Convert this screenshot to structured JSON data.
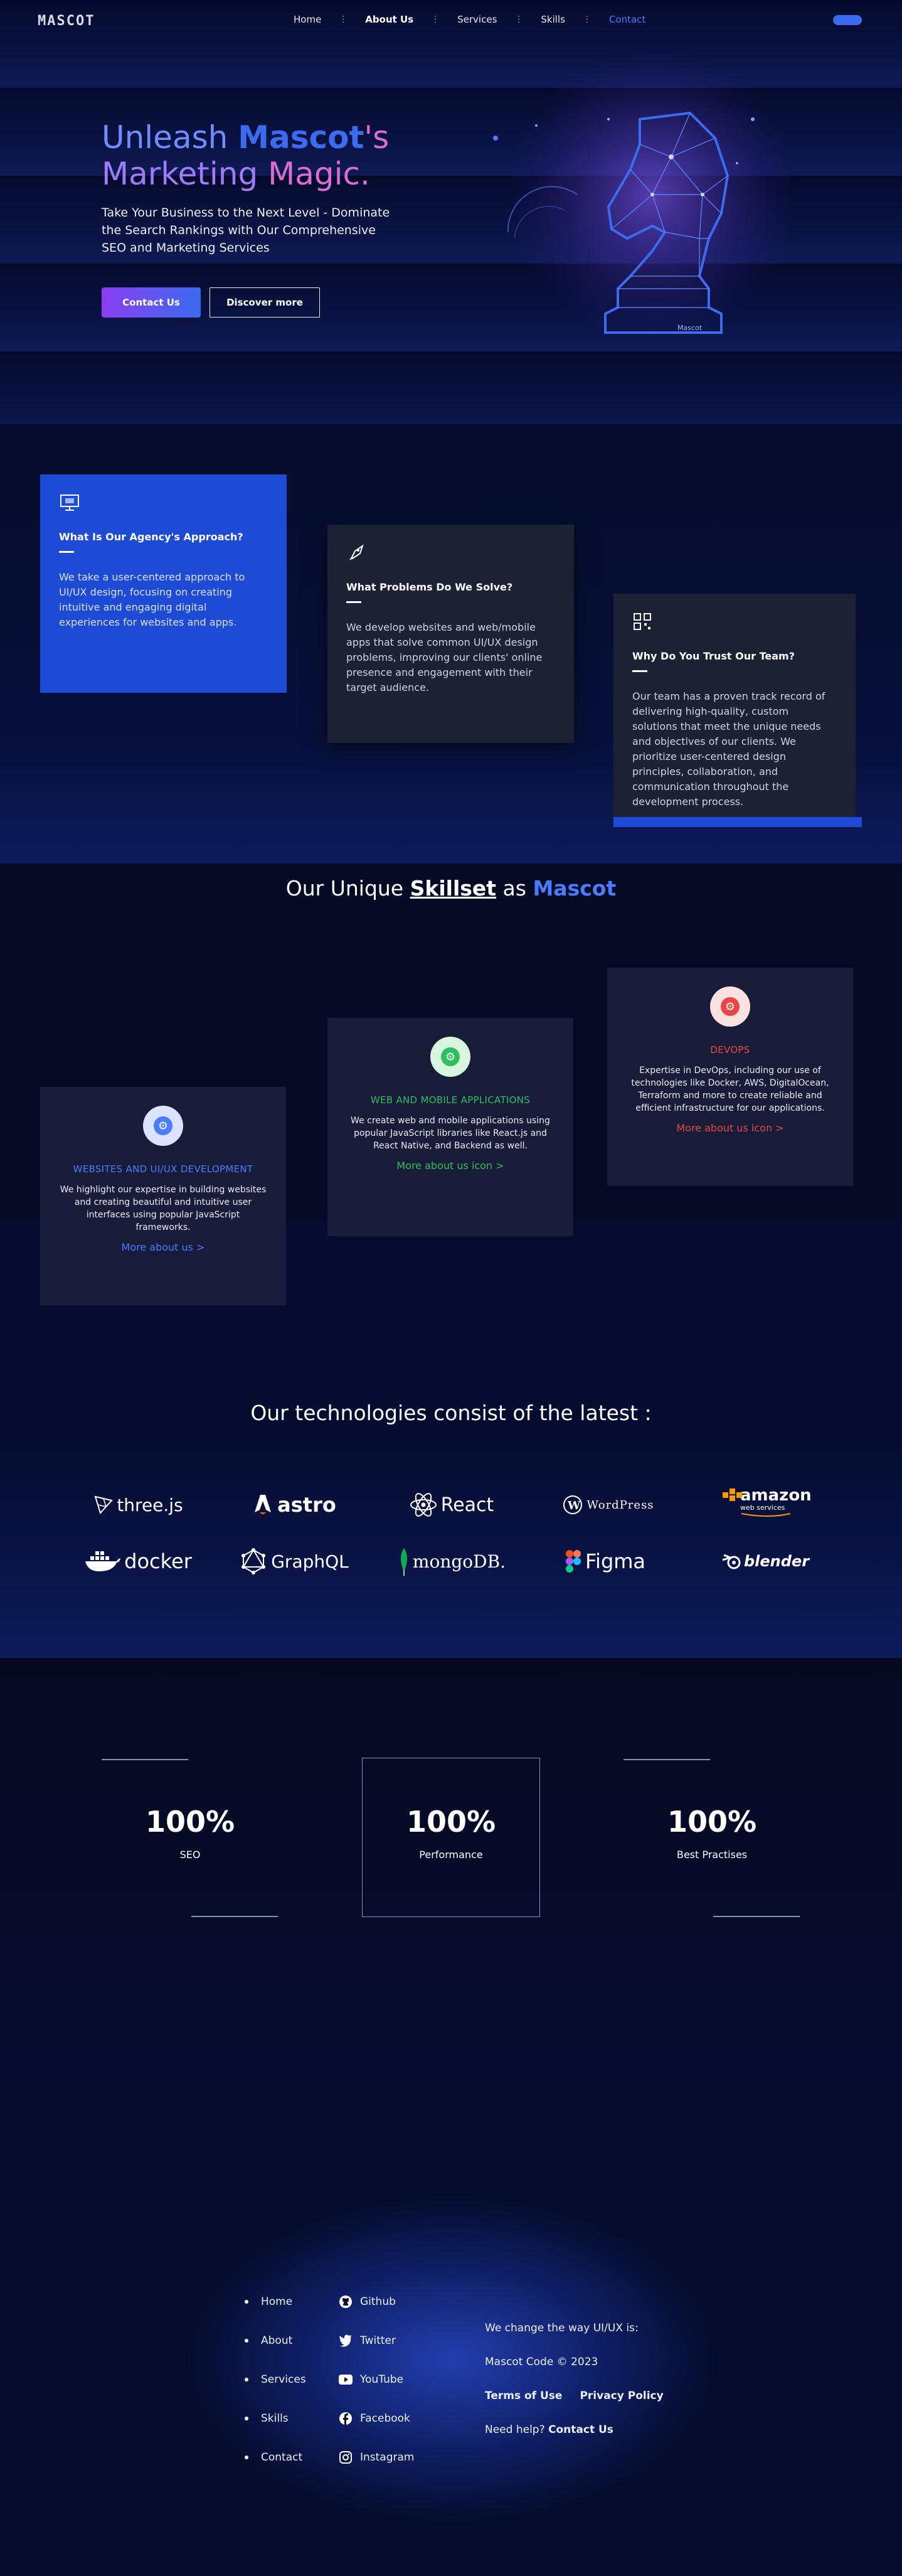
{
  "nav": {
    "logo": "MASCOT",
    "items": [
      "Home",
      "About Us",
      "Services",
      "Skills",
      "Contact"
    ],
    "active": "About Us"
  },
  "hero": {
    "title_1": "Unleash ",
    "title_brand": "Mascot",
    "title_2": "'s",
    "title_3": "Marketing ",
    "title_4": "Magic.",
    "subtitle": "Take Your Business to the Next Level - Dominate the Search Rankings with Our Comprehensive SEO and Marketing Services",
    "primary_button": "Contact Us",
    "secondary_button": "Discover more",
    "art_label": "Mascot"
  },
  "approach": [
    {
      "title": "What Is Our Agency's Approach?",
      "text": "We take a user-centered approach to UI/UX design, focusing on creating intuitive and engaging digital experiences for websites and apps.",
      "icon": "monitor-icon"
    },
    {
      "title": "What Problems Do We Solve?",
      "text": "We develop websites and web/mobile apps that solve common UI/UX design problems, improving our clients' online presence and engagement with their target audience.",
      "icon": "rocket-icon"
    },
    {
      "title": "Why Do You Trust Our Team?",
      "text": "Our team has a proven track record of delivering high-quality, custom solutions that meet the unique needs and objectives of our clients. We prioritize user-centered design principles, collaboration, and communication throughout the development process.",
      "icon": "qr-icon"
    }
  ],
  "skillset": {
    "title_1": "Our Unique ",
    "title_2": "Skillset",
    "title_3": " as ",
    "title_4": "Mascot",
    "cards": [
      {
        "title": "WEBSITES AND UI/UX DEVELOPMENT",
        "text": "We highlight our expertise in building websites and creating beautiful and intuitive user interfaces using popular JavaScript frameworks.",
        "link": "More about us >",
        "color": "#4a7cff"
      },
      {
        "title": "WEB AND MOBILE APPLICATIONS",
        "text": "We create web and mobile applications using popular JavaScript libraries like React.js and React Native, and Backend as well.",
        "link": "More about us icon >",
        "color": "#2fbf5e"
      },
      {
        "title": "DEVOPS",
        "text": "Expertise in DevOps, including our use of technologies like Docker, AWS, DigitalOcean, Terraform and more to create reliable and efficient infrastructure for our applications.",
        "link": "More about us icon >",
        "color": "#e84545"
      }
    ]
  },
  "technologies": {
    "title": "Our technologies consist of the latest :",
    "items": [
      "three.js",
      "astro",
      "React",
      "WordPress",
      "amazon",
      "web services",
      "docker",
      "GraphQL",
      "mongoDB.",
      "Figma",
      "blender"
    ]
  },
  "stats": [
    {
      "value": "100%",
      "label": "SEO"
    },
    {
      "value": "100%",
      "label": "Performance"
    },
    {
      "value": "100%",
      "label": "Best Practises"
    }
  ],
  "footer": {
    "links": [
      "Home",
      "About",
      "Services",
      "Skills",
      "Contact"
    ],
    "social": [
      "Github",
      "Twitter",
      "YouTube",
      "Facebook",
      "Instagram"
    ],
    "tagline": "We change the way UI/UX is:",
    "copyright": "Mascot Code © 2023",
    "terms": "Terms of Use",
    "privacy": "Privacy Policy",
    "help": "Need help?",
    "help_link": "Contact Us"
  },
  "colors": {
    "accent": "#3b6cf0",
    "background": "#050b2a",
    "card_blue": "#1e4bd6",
    "green": "#2fbf5e",
    "red": "#e84545"
  }
}
